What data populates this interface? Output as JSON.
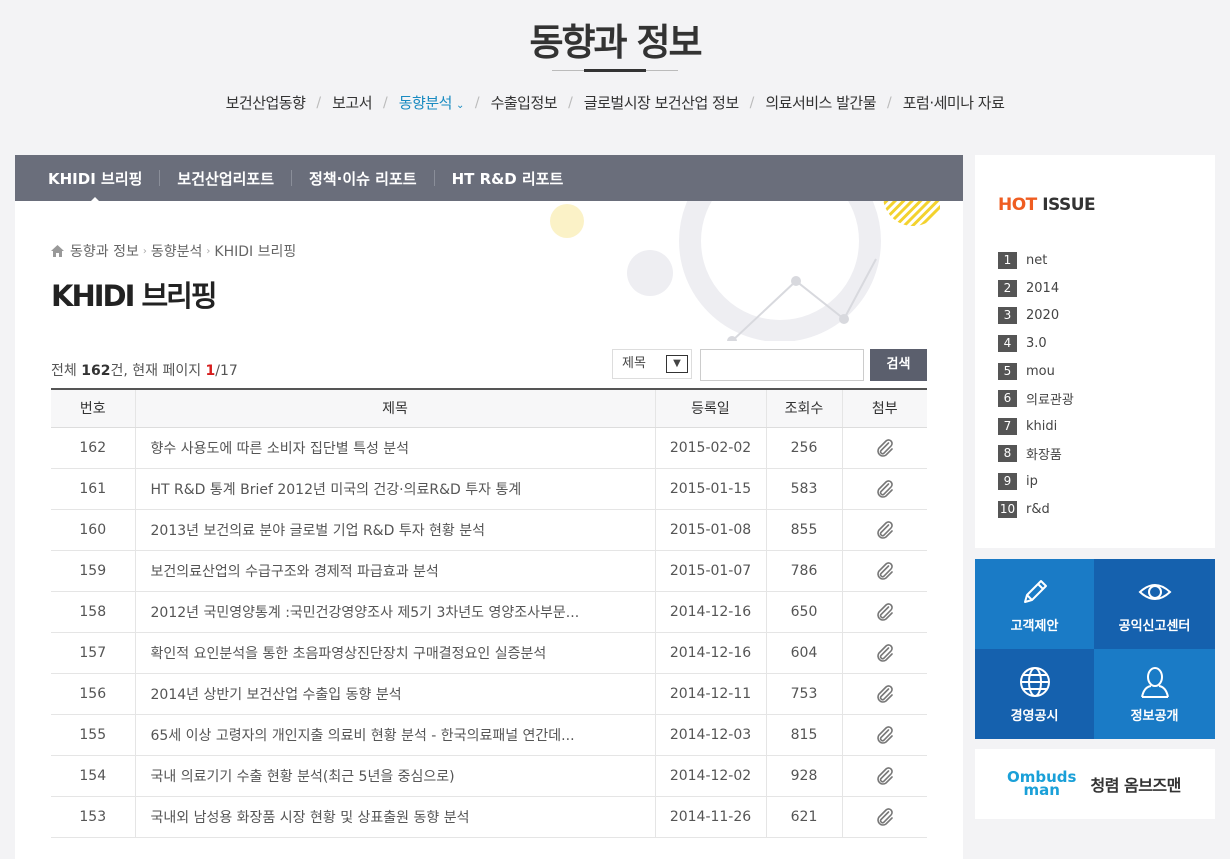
{
  "header": {
    "title": "동향과 정보",
    "nav": [
      {
        "label": "보건산업동향",
        "active": false
      },
      {
        "label": "보고서",
        "active": false
      },
      {
        "label": "동향분석",
        "active": true
      },
      {
        "label": "수출입정보",
        "active": false
      },
      {
        "label": "글로벌시장 보건산업 정보",
        "active": false
      },
      {
        "label": "의료서비스 발간물",
        "active": false
      },
      {
        "label": "포럼·세미나 자료",
        "active": false
      }
    ]
  },
  "subtabs": [
    "KHIDI 브리핑",
    "보건산업리포트",
    "정책·이슈 리포트",
    "HT R&D 리포트"
  ],
  "breadcrumb": [
    "동향과 정보",
    "동향분석",
    "KHIDI 브리핑"
  ],
  "content_title": "KHIDI 브리핑",
  "summary": {
    "prefix": "전체 ",
    "total": "162",
    "unit": "건, 현재 페이지 ",
    "current": "1",
    "pages": "/17"
  },
  "search": {
    "select_value": "제목",
    "button_label": "검색"
  },
  "table": {
    "headers": [
      "번호",
      "제목",
      "등록일",
      "조회수",
      "첨부"
    ],
    "rows": [
      {
        "no": "162",
        "title": "향수 사용도에 따른 소비자 집단별 특성 분석",
        "date": "2015-02-02",
        "views": "256"
      },
      {
        "no": "161",
        "title": "HT R&D 통계 Brief 2012년 미국의 건강·의료R&D 투자 통계",
        "date": "2015-01-15",
        "views": "583"
      },
      {
        "no": "160",
        "title": "2013년 보건의료 분야 글로벌 기업 R&D 투자 현황 분석",
        "date": "2015-01-08",
        "views": "855"
      },
      {
        "no": "159",
        "title": "보건의료산업의 수급구조와 경제적 파급효과 분석",
        "date": "2015-01-07",
        "views": "786"
      },
      {
        "no": "158",
        "title": "2012년 국민영양통계 :국민건강영양조사 제5기 3차년도 영양조사부문...",
        "date": "2014-12-16",
        "views": "650"
      },
      {
        "no": "157",
        "title": "확인적 요인분석을 통한 초음파영상진단장치 구매결정요인 실증분석",
        "date": "2014-12-16",
        "views": "604"
      },
      {
        "no": "156",
        "title": "2014년 상반기 보건산업 수출입 동향 분석",
        "date": "2014-12-11",
        "views": "753"
      },
      {
        "no": "155",
        "title": "65세 이상 고령자의 개인지출 의료비 현황 분석 - 한국의료패널 연간데...",
        "date": "2014-12-03",
        "views": "815"
      },
      {
        "no": "154",
        "title": "국내 의료기기 수출 현황 분석(최근 5년을 중심으로)",
        "date": "2014-12-02",
        "views": "928"
      },
      {
        "no": "153",
        "title": "국내외 남성용 화장품 시장 현황 및 상표출원 동향 분석",
        "date": "2014-11-26",
        "views": "621"
      }
    ]
  },
  "hot_issue": {
    "title_hot": "HOT",
    "title_issue": " ISSUE",
    "items": [
      "net",
      "2014",
      "2020",
      "3.0",
      "mou",
      "의료관광",
      "khidi",
      "화장품",
      "ip",
      "r&d"
    ]
  },
  "quick_links": [
    "고객제안",
    "공익신고센터",
    "경영공시",
    "정보공개"
  ],
  "ombudsman": {
    "logo_line1": "Ombuds",
    "logo_line2": "man",
    "label": "청렴 옴브즈맨"
  },
  "colors": {
    "accent": "#1a8bc1",
    "subtab_bar": "#6a6e7b",
    "hot": "#ef5d21",
    "quick_light": "#1a7bc6",
    "quick_dark": "#1561ae"
  }
}
